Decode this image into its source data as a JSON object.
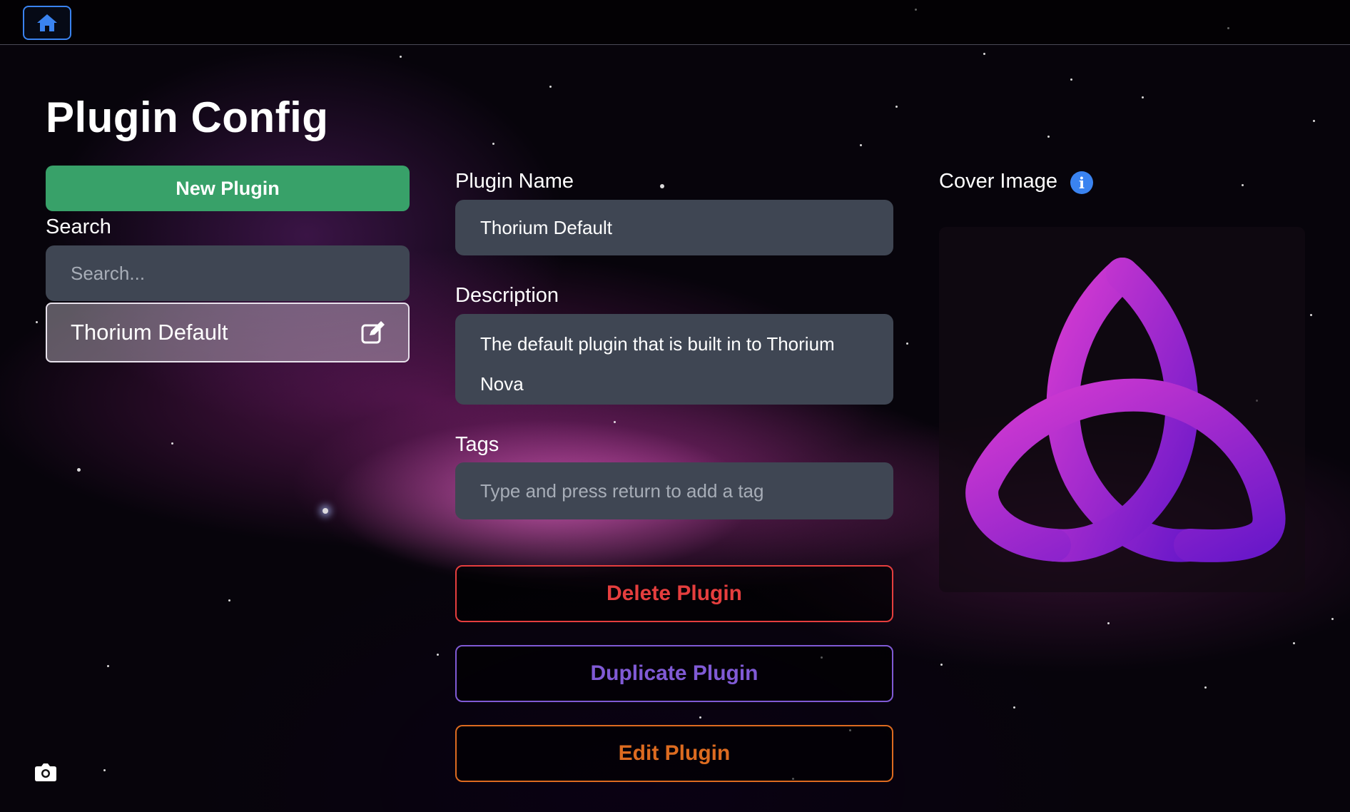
{
  "colors": {
    "accent_blue": "#3a83f0",
    "new_plugin_green": "#38a169",
    "delete_red": "#e53e3e",
    "duplicate_purple": "#805ad5",
    "edit_orange": "#dd6b20",
    "input_bg": "#3f4653"
  },
  "nav": {
    "home_icon": "home-icon"
  },
  "page": {
    "title": "Plugin Config"
  },
  "sidebar": {
    "new_plugin_label": "New Plugin",
    "search_label": "Search",
    "search_placeholder": "Search...",
    "items": [
      {
        "label": "Thorium Default",
        "icon": "edit-icon"
      }
    ]
  },
  "form": {
    "name_label": "Plugin Name",
    "name_value": "Thorium Default",
    "description_label": "Description",
    "description_value": "The default plugin that is built in to Thorium Nova",
    "tags_label": "Tags",
    "tags_placeholder": "Type and press return to add a tag",
    "delete_label": "Delete Plugin",
    "duplicate_label": "Duplicate Plugin",
    "edit_label": "Edit Plugin"
  },
  "cover": {
    "label": "Cover Image",
    "info_icon": "info-icon",
    "image": "triquetra-logo"
  },
  "footer": {
    "camera_icon": "camera-icon"
  }
}
